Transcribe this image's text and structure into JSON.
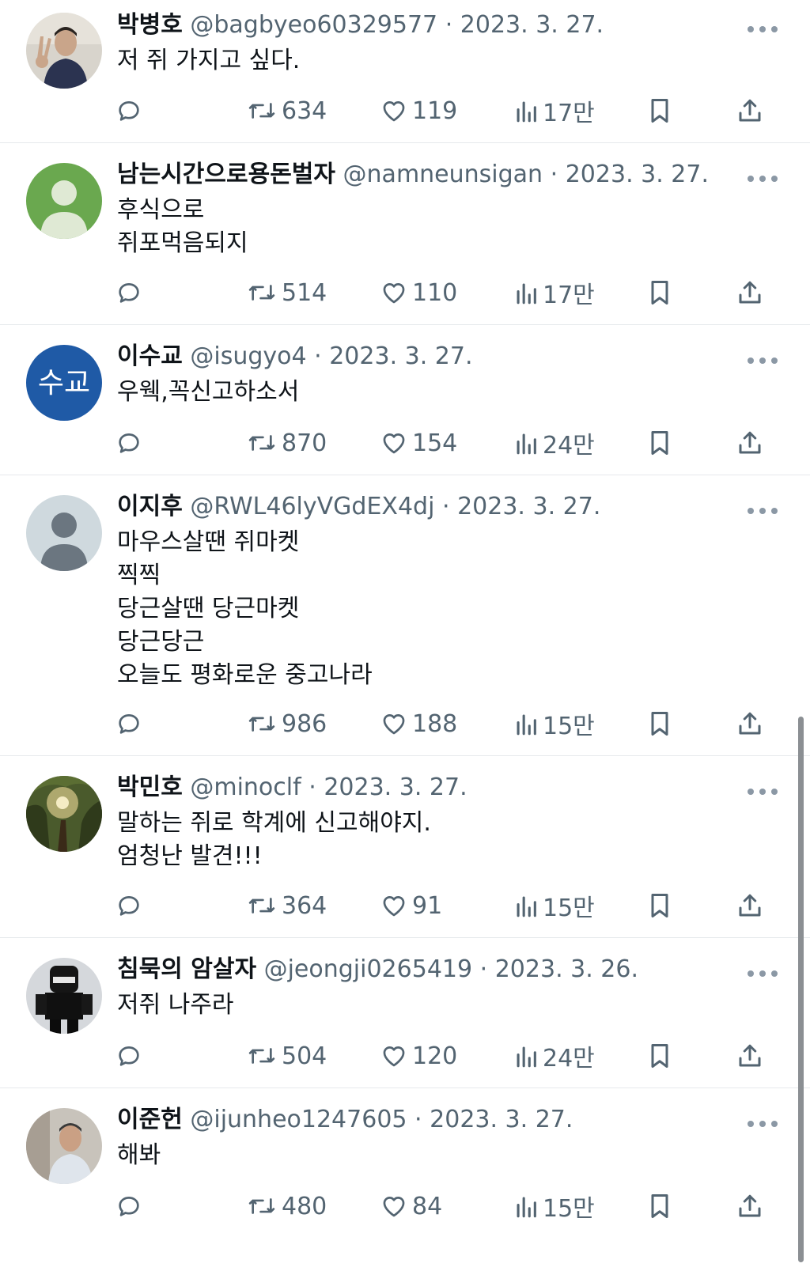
{
  "tweets": [
    {
      "name": "박병호",
      "handle": "@bagbyeo60329577",
      "date": "2023. 3. 27.",
      "lines": [
        "저 쥐 가지고 싶다."
      ],
      "retweets": "634",
      "likes": "119",
      "views": "17만",
      "avatar": "photo"
    },
    {
      "name": "남는시간으로용돈벌자",
      "handle": "@namneunsigan",
      "date": "2023. 3. 27.",
      "lines": [
        "후식으로",
        "쥐포먹음되지"
      ],
      "retweets": "514",
      "likes": "110",
      "views": "17만",
      "avatar": "default-green"
    },
    {
      "name": "이수교",
      "handle": "@isugyo4",
      "date": "2023. 3. 27.",
      "lines": [
        "우웩,꼭신고하소서"
      ],
      "retweets": "870",
      "likes": "154",
      "views": "24만",
      "avatar": "text",
      "avatar_text": "수교"
    },
    {
      "name": "이지후",
      "handle": "@RWL46lyVGdEX4dj",
      "date": "2023. 3. 27.",
      "lines": [
        "마우스살땐 쥐마켓",
        "찍찍",
        "당근살땐 당근마켓",
        "당근당근",
        "오늘도 평화로운 중고나라"
      ],
      "retweets": "986",
      "likes": "188",
      "views": "15만",
      "avatar": "default-gray"
    },
    {
      "name": "박민호",
      "handle": "@minoclf",
      "date": "2023. 3. 27.",
      "lines": [
        "말하는 쥐로 학계에 신고해야지.",
        "엄청난 발견!!!"
      ],
      "retweets": "364",
      "likes": "91",
      "views": "15만",
      "avatar": "forest"
    },
    {
      "name": "침묵의 암살자",
      "handle": "@jeongji0265419",
      "date": "2023. 3. 26.",
      "lines": [
        "저쥐 나주라"
      ],
      "retweets": "504",
      "likes": "120",
      "views": "24만",
      "avatar": "ninja"
    },
    {
      "name": "이준헌",
      "handle": "@ijunheo1247605",
      "date": "2023. 3. 27.",
      "lines": [
        "해봐"
      ],
      "retweets": "480",
      "likes": "84",
      "views": "15만",
      "avatar": "photo2"
    }
  ],
  "colors": {
    "text": "#0f1419",
    "secondary": "#536471",
    "divider": "#e6e9ec",
    "avatar_green": "#6aa84f",
    "avatar_blue": "#1f5aa6",
    "avatar_gray": "#cfd9de"
  },
  "icons": {
    "reply": "reply-icon",
    "retweet": "retweet-icon",
    "like": "heart-icon",
    "views": "views-icon",
    "bookmark": "bookmark-icon",
    "share": "share-icon",
    "more": "more-icon"
  }
}
